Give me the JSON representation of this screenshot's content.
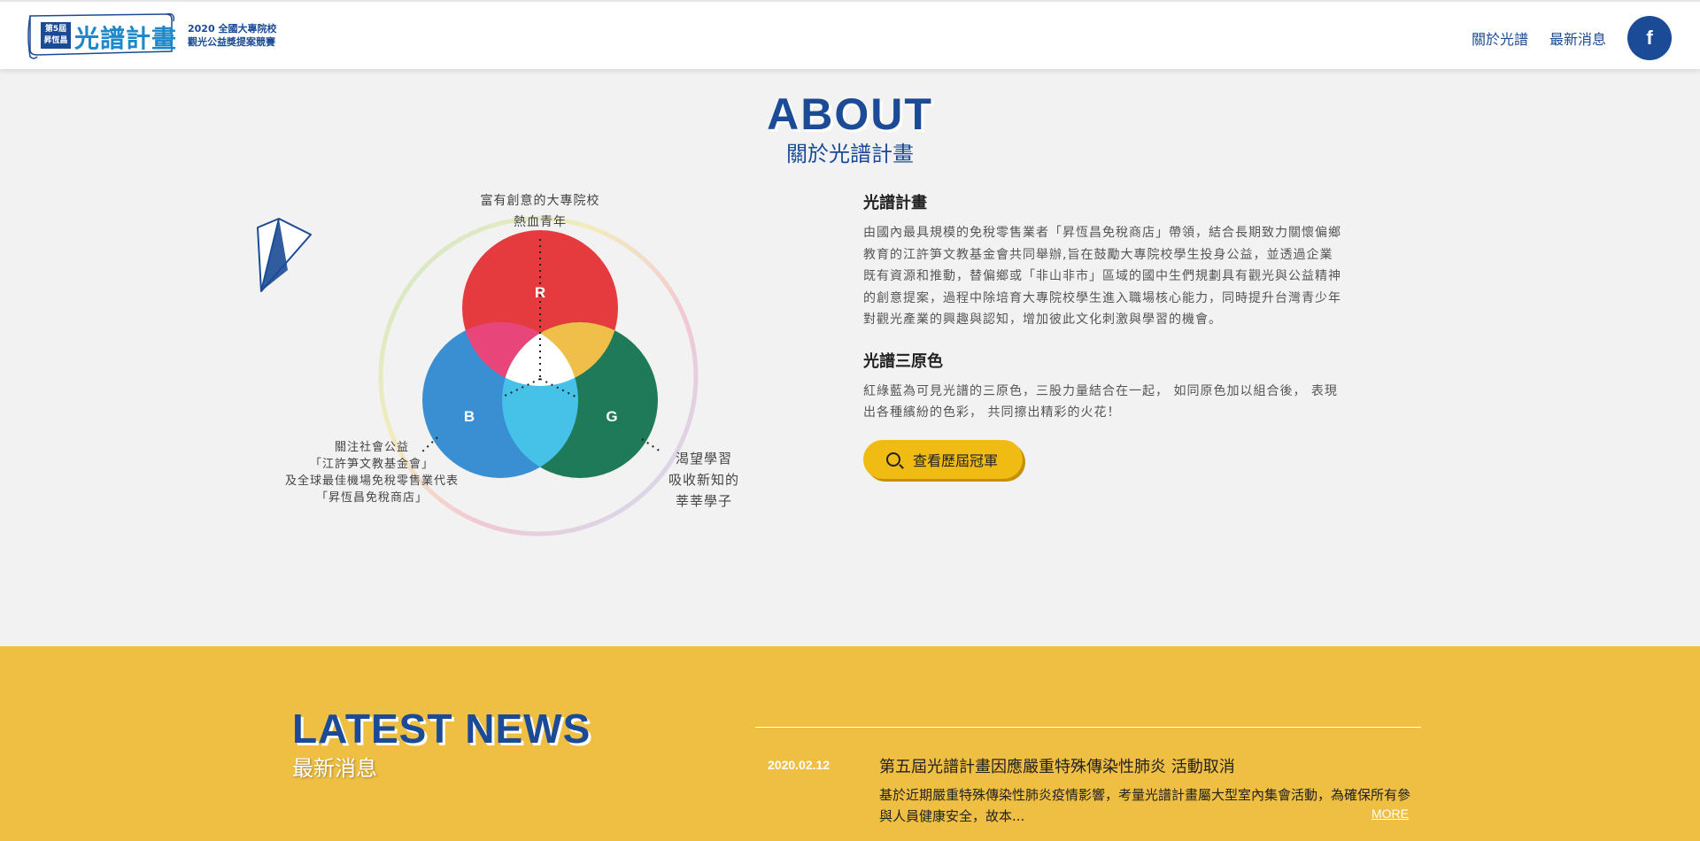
{
  "header": {
    "logo_badge_line1": "第5屆",
    "logo_badge_line2": "昇恆昌",
    "logo_name": "光譜計畫",
    "logo_sub_line1": "2020 全國大專院校",
    "logo_sub_line2": "觀光公益獎提案競賽",
    "nav": [
      {
        "label": "關於光譜"
      },
      {
        "label": "最新消息"
      }
    ],
    "facebook_label": "f"
  },
  "about": {
    "title_en": "ABOUT",
    "title_zh": "關於光譜計畫",
    "diagram": {
      "top_label_1": "富有創意的大專院校",
      "top_label_2": "熱血青年",
      "left_label_1": "關注社會公益",
      "left_label_2": "「江許笋文教基金會」",
      "left_label_3": "及全球最佳機場免稅零售業代表",
      "left_label_4": "「昇恆昌免稅商店」",
      "right_label_1": "渴望學習",
      "right_label_2": "吸收新知的",
      "right_label_3": "莘莘學子",
      "circle_r": "R",
      "circle_g": "G",
      "circle_b": "B",
      "colors": {
        "red": "#e53b3e",
        "green": "#1e7a58",
        "blue": "#3a8fd2",
        "pink": "#e8467a",
        "yellow": "#f0bf4a",
        "cyan": "#46c1e8"
      }
    },
    "section1_title": "光譜計畫",
    "section1_text": "由國內最具規模的免稅零售業者「昇恆昌免稅商店」帶領，結合長期致力關懷偏鄉教育的江許笋文教基金會共同舉辦,旨在鼓勵大專院校學生投身公益，並透過企業既有資源和推動，替偏鄉或「非山非市」區域的國中生們規劃具有觀光與公益精神的創意提案，過程中除培育大專院校學生進入職場核心能力，同時提升台灣青少年對觀光產業的興趣與認知，增加彼此文化刺激與學習的機會。",
    "section2_title": "光譜三原色",
    "section2_text": "紅綠藍為可見光譜的三原色，三股力量結合在一起， 如同原色加以組合後， 表現出各種繽紛的色彩， 共同擦出精彩的火花！",
    "button_label": "查看歷屆冠軍"
  },
  "news": {
    "title_en": "LATEST NEWS",
    "title_zh": "最新消息",
    "items": [
      {
        "date": "2020.02.12",
        "title": "第五屆光譜計畫因應嚴重特殊傳染性肺炎 活動取消",
        "body": "基於近期嚴重特殊傳染性肺炎疫情影響，考量光譜計畫屬大型室內集會活動，為確保所有參與人員健康安全，故本...",
        "more": "MORE"
      }
    ]
  }
}
